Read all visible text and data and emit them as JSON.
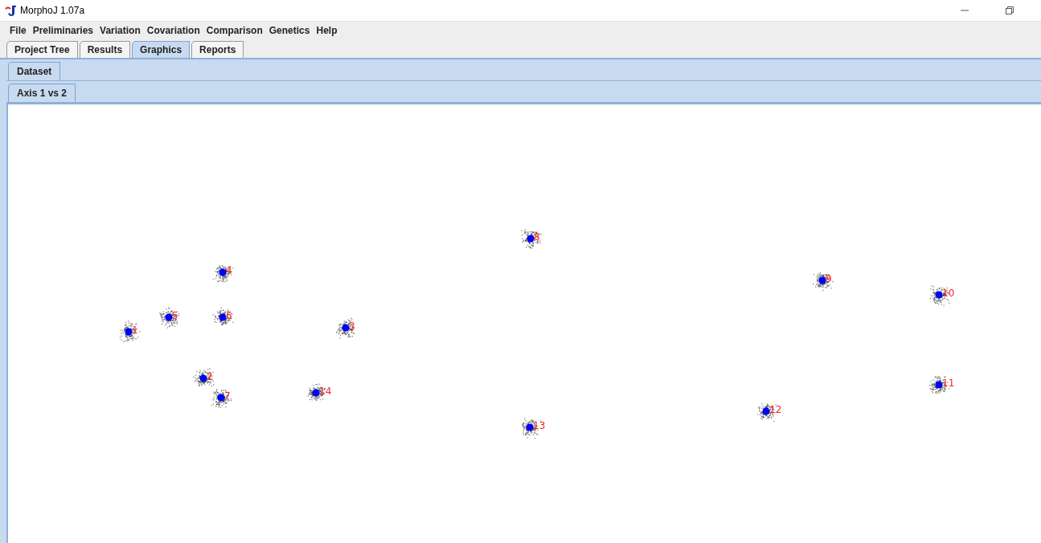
{
  "window": {
    "title": "MorphoJ 1.07a"
  },
  "menu": [
    "File",
    "Preliminaries",
    "Variation",
    "Covariation",
    "Comparison",
    "Genetics",
    "Help"
  ],
  "tabs": [
    {
      "label": "Project Tree",
      "selected": false
    },
    {
      "label": "Results",
      "selected": false
    },
    {
      "label": "Graphics",
      "selected": true
    },
    {
      "label": "Reports",
      "selected": false
    }
  ],
  "dataset_tabs": [
    {
      "label": "Dataset",
      "selected": true
    }
  ],
  "plot_tabs": [
    {
      "label": "Axis 1 vs 2",
      "selected": true
    }
  ],
  "plot": {
    "landmarks": [
      {
        "label": "1"
      },
      {
        "label": "2"
      },
      {
        "label": "3"
      },
      {
        "label": "4"
      },
      {
        "label": "5"
      },
      {
        "label": "6"
      },
      {
        "label": "7"
      },
      {
        "label": "8"
      },
      {
        "label": "9"
      },
      {
        "label": "10"
      },
      {
        "label": "11"
      },
      {
        "label": "12"
      },
      {
        "label": "13"
      },
      {
        "label": "14"
      }
    ]
  }
}
